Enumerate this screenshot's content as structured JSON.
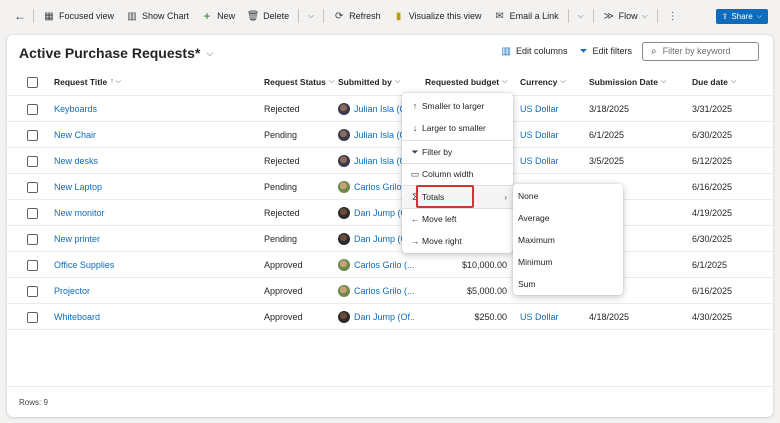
{
  "toolbar": {
    "focused_view": "Focused view",
    "show_chart": "Show Chart",
    "new": "New",
    "delete": "Delete",
    "refresh": "Refresh",
    "visualize": "Visualize this view",
    "email_link": "Email a Link",
    "flow": "Flow",
    "share": "Share"
  },
  "view": {
    "title": "Active Purchase Requests*",
    "edit_columns": "Edit columns",
    "edit_filters": "Edit filters",
    "search_placeholder": "Filter by keyword"
  },
  "columns": {
    "title": "Request Title",
    "status": "Request Status",
    "submitted_by": "Submitted by",
    "budget": "Requested budget",
    "currency": "Currency",
    "submission_date": "Submission Date",
    "due_date": "Due date"
  },
  "rows": [
    {
      "title": "Keyboards",
      "status": "Rejected",
      "submitted_by": "Julian Isla (O",
      "avatar": "julian",
      "budget": "",
      "currency": "US Dollar",
      "submission_date": "3/18/2025",
      "due": "3/31/2025"
    },
    {
      "title": "New Chair",
      "status": "Pending",
      "submitted_by": "Julian Isla (O",
      "avatar": "julian",
      "budget": "",
      "currency": "US Dollar",
      "submission_date": "6/1/2025",
      "due": "6/30/2025"
    },
    {
      "title": "New desks",
      "status": "Rejected",
      "submitted_by": "Julian Isla (O",
      "avatar": "julian",
      "budget": "",
      "currency": "US Dollar",
      "submission_date": "3/5/2025",
      "due": "6/12/2025"
    },
    {
      "title": "New Laptop",
      "status": "Pending",
      "submitted_by": "Carlos Grilo",
      "avatar": "carlos",
      "budget": "",
      "currency": "",
      "submission_date": "",
      "due": "6/16/2025"
    },
    {
      "title": "New monitor",
      "status": "Rejected",
      "submitted_by": "Dan Jump (O",
      "avatar": "dan",
      "budget": "",
      "currency": "",
      "submission_date": "",
      "due": "4/19/2025"
    },
    {
      "title": "New printer",
      "status": "Pending",
      "submitted_by": "Dan Jump (O",
      "avatar": "dan",
      "budget": "",
      "currency": "",
      "submission_date": "",
      "due": "6/30/2025"
    },
    {
      "title": "Office Supplies",
      "status": "Approved",
      "submitted_by": "Carlos Grilo (...",
      "avatar": "carlos",
      "budget": "$10,000.00",
      "currency": "",
      "submission_date": "25",
      "due": "6/1/2025"
    },
    {
      "title": "Projector",
      "status": "Approved",
      "submitted_by": "Carlos Grilo (...",
      "avatar": "carlos",
      "budget": "$5,000.00",
      "currency": "",
      "submission_date": "",
      "due": "6/16/2025"
    },
    {
      "title": "Whiteboard",
      "status": "Approved",
      "submitted_by": "Dan Jump (Of...",
      "avatar": "dan",
      "budget": "$250.00",
      "currency": "US Dollar",
      "submission_date": "4/18/2025",
      "due": "4/30/2025"
    }
  ],
  "footer": {
    "rows": "Rows: 9"
  },
  "column_menu": {
    "smaller_to_larger": "Smaller to larger",
    "larger_to_smaller": "Larger to smaller",
    "filter_by": "Filter by",
    "column_width": "Column width",
    "totals": "Totals",
    "move_left": "Move left",
    "move_right": "Move right"
  },
  "totals_menu": [
    "None",
    "Average",
    "Maximum",
    "Minimum",
    "Sum"
  ],
  "colors": {
    "accent": "#0f6cbd",
    "highlight_border": "#d13438"
  }
}
